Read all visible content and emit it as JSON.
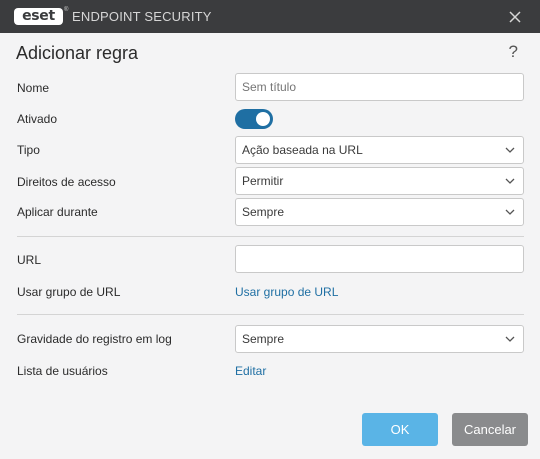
{
  "titlebar": {
    "logo_text": "eset",
    "logo_mark": "®",
    "app_name": "ENDPOINT SECURITY",
    "close_icon": "close-icon"
  },
  "dialog": {
    "title": "Adicionar regra",
    "help_glyph": "?"
  },
  "form": {
    "name_label": "Nome",
    "name_placeholder": "Sem título",
    "enabled_label": "Ativado",
    "enabled": true,
    "type_label": "Tipo",
    "type_value": "Ação baseada na URL",
    "access_label": "Direitos de acesso",
    "access_value": "Permitir",
    "apply_label": "Aplicar durante",
    "apply_value": "Sempre",
    "url_label": "URL",
    "url_value": "",
    "url_group_label": "Usar grupo de URL",
    "url_group_link": "Usar grupo de URL",
    "log_label": "Gravidade do registro em log",
    "log_value": "Sempre",
    "users_label": "Lista de usuários",
    "users_link": "Editar"
  },
  "footer": {
    "ok_label": "OK",
    "cancel_label": "Cancelar"
  },
  "colors": {
    "titlebar": "#3b3c3e",
    "accent": "#1f6fa3",
    "ok_button": "#5ab4e6",
    "cancel_button": "#8a8b8d"
  }
}
